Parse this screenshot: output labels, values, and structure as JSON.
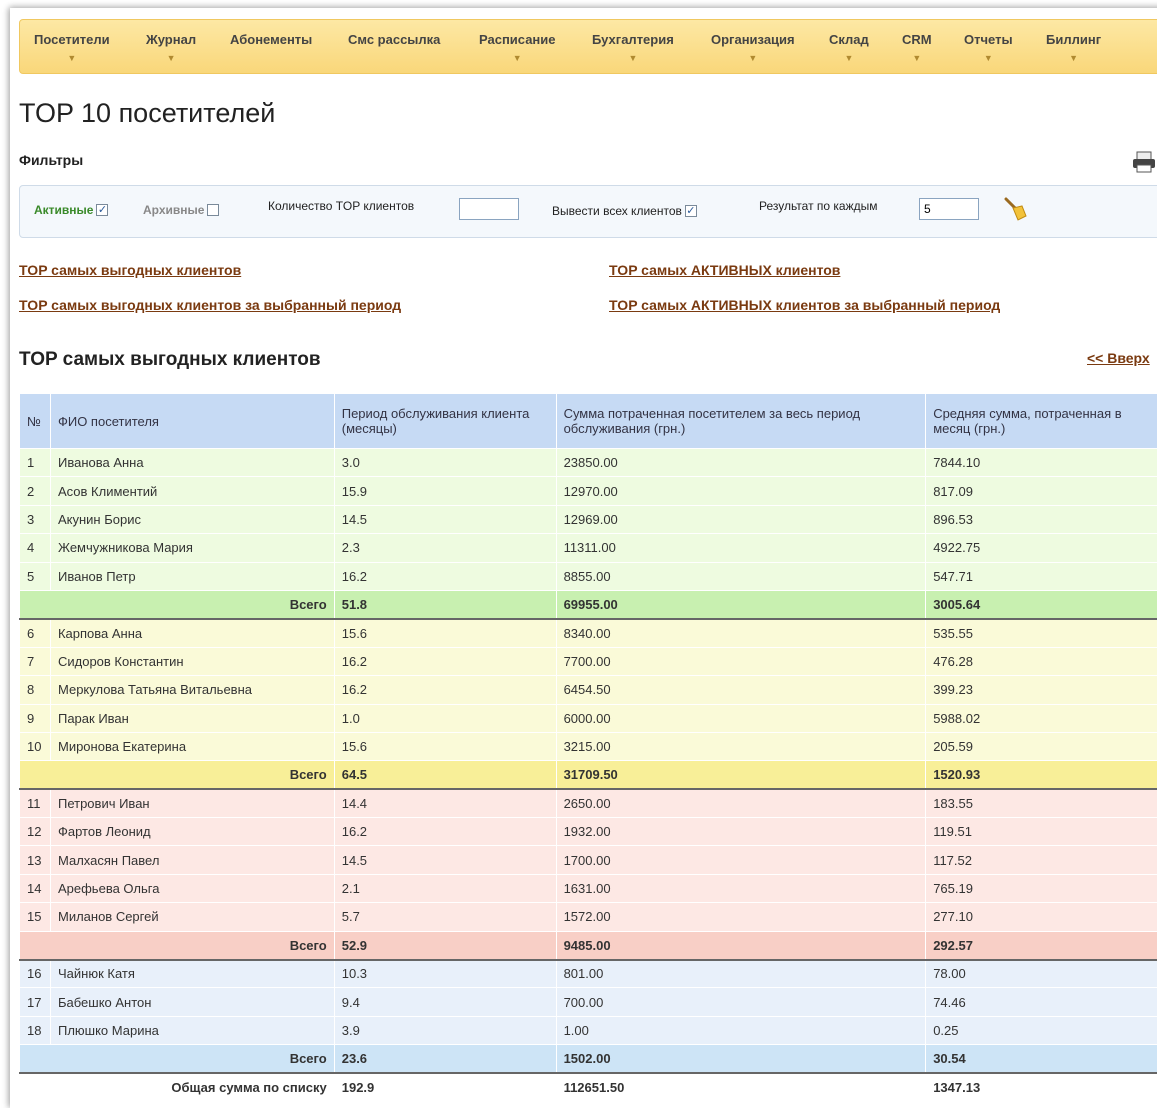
{
  "menu": [
    {
      "label": "Посетители",
      "arrow": "▼"
    },
    {
      "label": "Журнал",
      "arrow": "▼"
    },
    {
      "label": "Абонементы",
      "arrow": ""
    },
    {
      "label": "Смс рассылка",
      "arrow": ""
    },
    {
      "label": "Расписание",
      "arrow": "▼"
    },
    {
      "label": "Бухгалтерия",
      "arrow": "▼"
    },
    {
      "label": "Организация",
      "arrow": "▼"
    },
    {
      "label": "Склад",
      "arrow": "▼"
    },
    {
      "label": "CRM",
      "arrow": "▼"
    },
    {
      "label": "Отчеты",
      "arrow": "▼"
    },
    {
      "label": "Биллинг",
      "arrow": "▼"
    }
  ],
  "page_title": "TOP 10 посетителей",
  "filters": {
    "label": "Фильтры",
    "active_label": "Активные",
    "active_checked": "✓",
    "archive_label": "Архивные",
    "top_count_label": "Количество TOP клиентов",
    "top_count_value": "",
    "all_clients_label": "Вывести всех клиентов",
    "all_clients_checked": "✓",
    "result_label": "Результат по каждым",
    "result_value": "5"
  },
  "links": {
    "profitable": "TOP самых выгодных клиентов",
    "profitable_period": "TOP самых выгодных клиентов за выбранный период",
    "active": "TOP самых АКТИВНЫХ клиентов",
    "active_period": "TOP самых АКТИВНЫХ клиентов за выбранный период"
  },
  "section_title": "TOP самых выгодных клиентов",
  "up_link": "<< Вверх",
  "table": {
    "headers": [
      "№",
      "ФИО посетителя",
      "Период обслуживания клиента (месяцы)",
      "Сумма потраченная посетителем за весь период обслуживания (грн.)",
      "Средняя сумма, потраченная в месяц (грн.)"
    ],
    "total_label": "Всего",
    "grand_label": "Общая сумма по списку",
    "groups": [
      {
        "rows": [
          [
            "1",
            "Иванова Анна",
            "3.0",
            "23850.00",
            "7844.10"
          ],
          [
            "2",
            "Асов Климентий",
            "15.9",
            "12970.00",
            "817.09"
          ],
          [
            "3",
            "Акунин Борис",
            "14.5",
            "12969.00",
            "896.53"
          ],
          [
            "4",
            "Жемчужникова Мария",
            "2.3",
            "11311.00",
            "4922.75"
          ],
          [
            "5",
            "Иванов Петр",
            "16.2",
            "8855.00",
            "547.71"
          ]
        ],
        "total": [
          "51.8",
          "69955.00",
          "3005.64"
        ]
      },
      {
        "rows": [
          [
            "6",
            "Карпова Анна",
            "15.6",
            "8340.00",
            "535.55"
          ],
          [
            "7",
            "Сидоров Константин",
            "16.2",
            "7700.00",
            "476.28"
          ],
          [
            "8",
            "Меркулова Татьяна Витальевна",
            "16.2",
            "6454.50",
            "399.23"
          ],
          [
            "9",
            "Парак Иван",
            "1.0",
            "6000.00",
            "5988.02"
          ],
          [
            "10",
            "Миронова Екатерина",
            "15.6",
            "3215.00",
            "205.59"
          ]
        ],
        "total": [
          "64.5",
          "31709.50",
          "1520.93"
        ]
      },
      {
        "rows": [
          [
            "11",
            "Петрович Иван",
            "14.4",
            "2650.00",
            "183.55"
          ],
          [
            "12",
            "Фартов Леонид",
            "16.2",
            "1932.00",
            "119.51"
          ],
          [
            "13",
            "Малхасян Павел",
            "14.5",
            "1700.00",
            "117.52"
          ],
          [
            "14",
            "Арефьева Ольга",
            "2.1",
            "1631.00",
            "765.19"
          ],
          [
            "15",
            "Миланов Сергей",
            "5.7",
            "1572.00",
            "277.10"
          ]
        ],
        "total": [
          "52.9",
          "9485.00",
          "292.57"
        ]
      },
      {
        "rows": [
          [
            "16",
            "Чайнюк Катя",
            "10.3",
            "801.00",
            "78.00"
          ],
          [
            "17",
            "Бабешко Антон",
            "9.4",
            "700.00",
            "74.46"
          ],
          [
            "18",
            "Плюшко Марина",
            "3.9",
            "1.00",
            "0.25"
          ]
        ],
        "total": [
          "23.6",
          "1502.00",
          "30.54"
        ]
      }
    ],
    "grand_total": [
      "192.9",
      "112651.50",
      "1347.13"
    ]
  }
}
